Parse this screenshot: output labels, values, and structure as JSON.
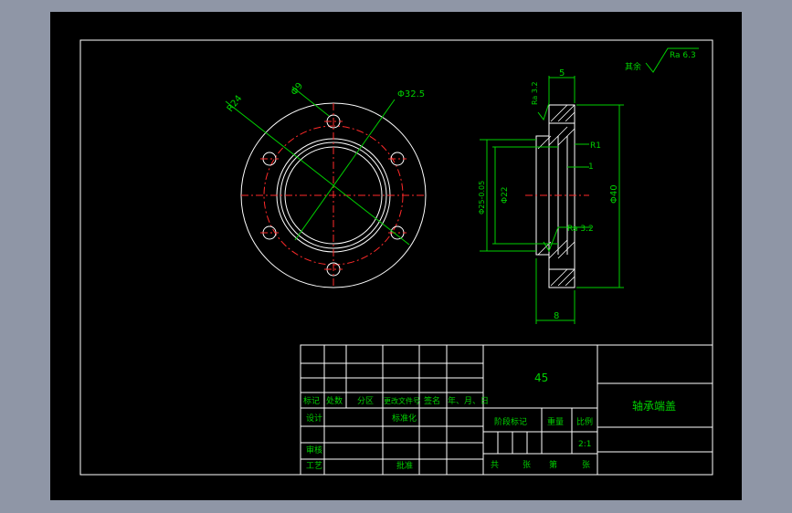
{
  "colors": {
    "background": "#000000",
    "outline": "#ffffff",
    "dimension": "#00d000",
    "centerline": "#ff2a2a",
    "window": "#8f96a6"
  },
  "roughness_note": {
    "rest_label": "其余",
    "value": "Ra 6.3"
  },
  "front_view": {
    "dims": {
      "r24": "R24",
      "d9": "Φ9",
      "d32": "Φ32.5"
    }
  },
  "section_view": {
    "dims": {
      "top": "5",
      "ra_top": "Ra 3.2",
      "r1": "R1",
      "one": "1",
      "d25": "Φ25-0.05",
      "d22": "Φ22",
      "d40": "Φ40",
      "ra_bottom": "Ra 3.2",
      "bottom": "8"
    }
  },
  "title_block": {
    "material": "45",
    "part_name": "轴承端盖",
    "revision_headers": [
      "标记",
      "处数",
      "分区",
      "更改文件号",
      "签名",
      "年、月、日"
    ],
    "design_label": "设计",
    "standardize_label": "标准化",
    "review_label": "审核",
    "process_label": "工艺",
    "approve_label": "批准",
    "stage_mark_label": "阶段标记",
    "weight_label": "重量",
    "scale_label": "比例",
    "scale_value": "2:1",
    "sheet_total": "共",
    "sheet_unit": "张",
    "sheet_number": "第",
    "sheet_unit2": "张"
  }
}
